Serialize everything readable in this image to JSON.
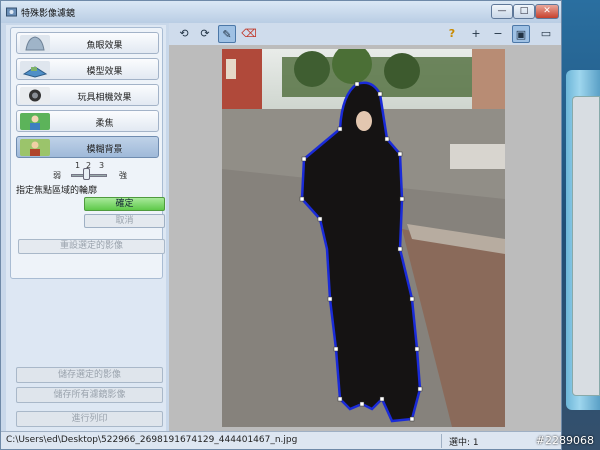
{
  "window": {
    "title": "特殊影像濾鏡"
  },
  "window_controls": {
    "minimize": "—",
    "maximize": "□",
    "close": "✕"
  },
  "effects": [
    {
      "label": "魚眼效果",
      "icon": "fisheye-icon"
    },
    {
      "label": "模型效果",
      "icon": "miniature-icon"
    },
    {
      "label": "玩具相機效果",
      "icon": "toy-camera-icon"
    },
    {
      "label": "柔焦",
      "icon": "soft-focus-icon"
    },
    {
      "label": "模糊背景",
      "icon": "blur-background-icon",
      "active": true
    }
  ],
  "strength": {
    "weak": "弱",
    "strong": "強",
    "ticks": [
      "1",
      "2",
      "3"
    ],
    "value": 2
  },
  "focus_label": "指定焦點區域的輪廓",
  "buttons": {
    "ok": "確定",
    "cancel": "取消",
    "reset": "重設選定的影像",
    "save_selected": "儲存選定的影像",
    "save_all": "儲存所有濾鏡影像",
    "print": "進行列印"
  },
  "toolbar": [
    {
      "name": "rotate-left-icon",
      "glyph": "⟲"
    },
    {
      "name": "rotate-right-icon",
      "glyph": "⟳"
    },
    {
      "name": "draw-outline-icon",
      "glyph": "✎",
      "active": true
    },
    {
      "name": "clear-outline-icon",
      "glyph": "⌫"
    }
  ],
  "toolbar_right": [
    {
      "name": "help-icon",
      "glyph": "?"
    },
    {
      "name": "zoom-in-icon",
      "glyph": "+"
    },
    {
      "name": "zoom-out-icon",
      "glyph": "−"
    },
    {
      "name": "view-image-icon",
      "glyph": "▣",
      "active": true
    },
    {
      "name": "fit-window-icon",
      "glyph": "▭"
    }
  ],
  "status": {
    "path": "C:\\Users\\ed\\Desktop\\522966_2698191674129_444401467_n.jpg",
    "selection": "選中: 1"
  },
  "watermark": "#2289068",
  "colors": {
    "accent": "#4c78a8",
    "ok_green": "#5fc94a",
    "outline": "#1a2bd8"
  }
}
